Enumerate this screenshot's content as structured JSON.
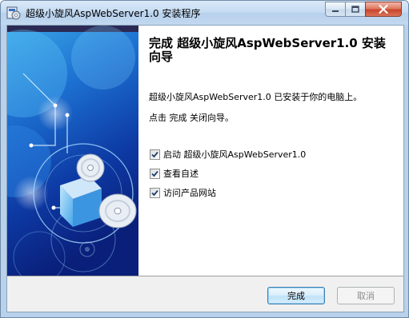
{
  "window": {
    "title": "超级小旋风AspWebServer1.0  安装程序",
    "controls": {
      "minimize": "minimize",
      "maximize": "maximize",
      "close": "close"
    }
  },
  "content": {
    "heading": "完成 超级小旋风AspWebServer1.0 安装向导",
    "installed_text": "超级小旋风AspWebServer1.0 已安装于你的电脑上。",
    "close_hint": "点击 完成 关闭向导。",
    "options": [
      {
        "label": "启动 超级小旋风AspWebServer1.0",
        "checked": true
      },
      {
        "label": "查看自述",
        "checked": true
      },
      {
        "label": "访问产品网站",
        "checked": true
      }
    ]
  },
  "buttons": {
    "finish": "完成",
    "cancel": "取消"
  },
  "colors": {
    "banner_dark": "#0a1f7a",
    "banner_light": "#3aa7e8",
    "accent": "#3c7fb1"
  },
  "icons": [
    "installer-app-icon",
    "minimize-icon",
    "maximize-icon",
    "close-icon",
    "checkmark-icon",
    "cd-box-illustration"
  ]
}
